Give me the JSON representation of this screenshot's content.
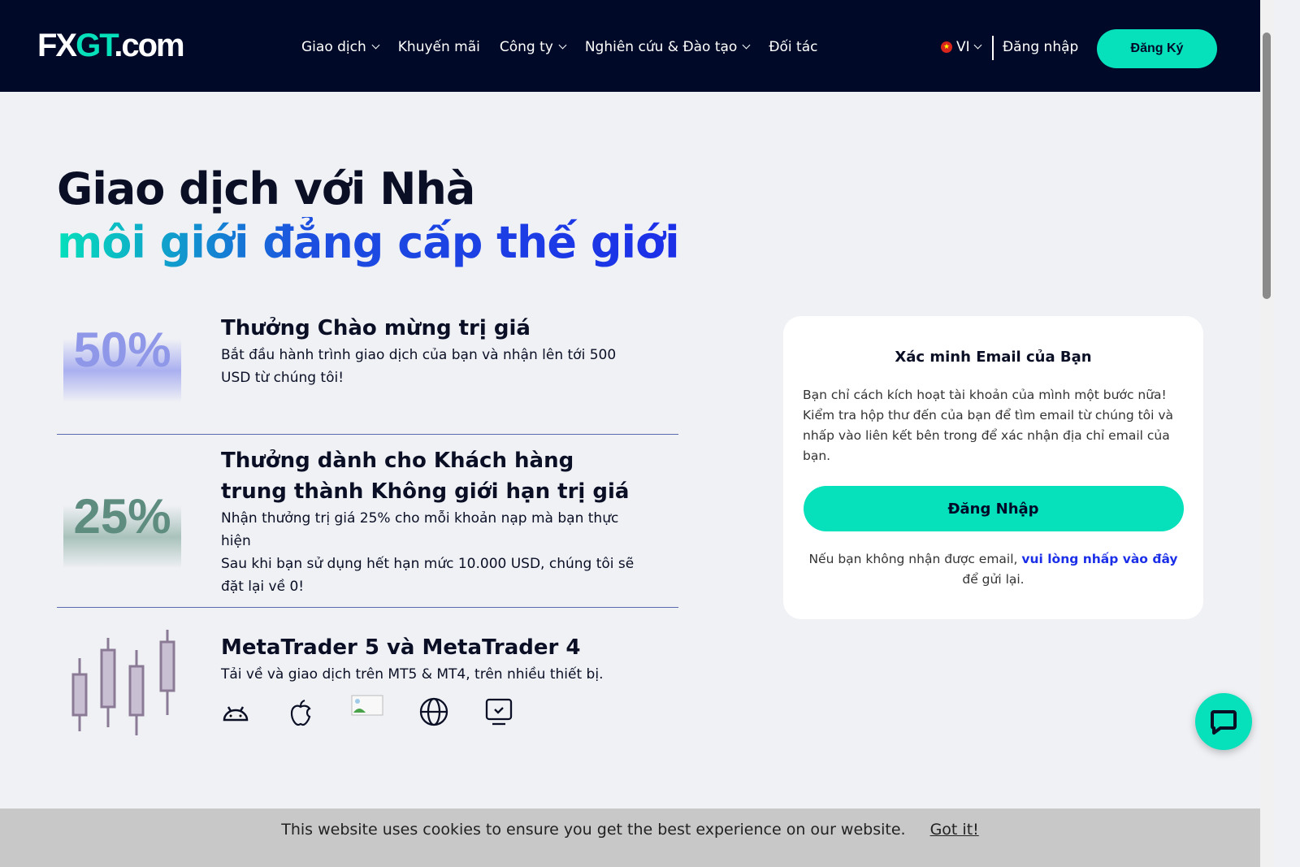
{
  "nav": {
    "logo": "FXGT.com",
    "logo_a": "FX",
    "logo_b": "GT",
    "logo_c": ".com",
    "items": [
      {
        "label": "Giao dịch",
        "dropdown": true
      },
      {
        "label": "Khuyến mãi",
        "dropdown": false
      },
      {
        "label": "Công ty",
        "dropdown": true
      },
      {
        "label": "Nghiên cứu & Đào tạo",
        "dropdown": true
      },
      {
        "label": "Đối tác",
        "dropdown": false
      }
    ],
    "lang": "VI",
    "login": "Đăng nhập",
    "register": "Đăng Ký"
  },
  "hero": {
    "line1": "Giao dịch với Nhà",
    "line2": "môi giới đẳng cấp thế giới"
  },
  "features": [
    {
      "badge": "50%",
      "title": "Thưởng Chào mừng trị giá",
      "desc": [
        "Bắt đầu hành trình giao dịch của bạn và nhận lên tới 500 USD từ chúng tôi!"
      ]
    },
    {
      "badge": "25%",
      "title": "Thưởng dành cho Khách hàng trung thành Không giới hạn trị giá",
      "desc": [
        "Nhận thưởng trị giá 25% cho mỗi khoản nạp mà bạn thực hiện",
        "Sau khi bạn sử dụng hết hạn mức 10.000 USD, chúng tôi sẽ đặt lại về 0!"
      ]
    },
    {
      "title": "MetaTrader 5 và MetaTrader 4",
      "desc": [
        "Tải về và giao dịch trên MT5 & MT4, trên nhiều thiết bị."
      ],
      "platforms": [
        "android-icon",
        "apple-icon",
        "broken-image-icon",
        "globe-icon",
        "desktop-icon"
      ]
    }
  ],
  "card": {
    "title": "Xác minh Email của Bạn",
    "desc": "Bạn chỉ cách kích hoạt tài khoản của mình một bước nữa! Kiểm tra hộp thư đến của bạn để tìm email từ chúng tôi và nhấp vào liên kết bên trong để xác nhận địa chỉ email của bạn.",
    "button": "Đăng Nhập",
    "note_pre": "Nếu bạn không nhận được email, ",
    "note_link": "vui lòng nhấp vào đây",
    "note_post": " để gửi lại."
  },
  "cookie": {
    "text": "This website uses cookies to ensure you get the best experience on our website.",
    "accept": "Got it!"
  },
  "colors": {
    "navy": "#000a28",
    "accent": "#06e0bb",
    "blue": "#1c2fe8"
  }
}
